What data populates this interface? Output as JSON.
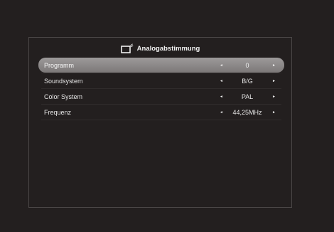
{
  "dialog": {
    "title": "Analogabstimmung",
    "icon": "tv-antenna-icon"
  },
  "rows": [
    {
      "label": "Programm",
      "value": "0",
      "selected": true
    },
    {
      "label": "Soundsystem",
      "value": "B/G",
      "selected": false
    },
    {
      "label": "Color System",
      "value": "PAL",
      "selected": false
    },
    {
      "label": "Frequenz",
      "value": "44,25MHz",
      "selected": false
    }
  ],
  "arrows": {
    "left": "◄",
    "right": "►"
  },
  "colors": {
    "background": "#231f1f",
    "selection": "#8b8787",
    "text": "#e6e6e6"
  }
}
